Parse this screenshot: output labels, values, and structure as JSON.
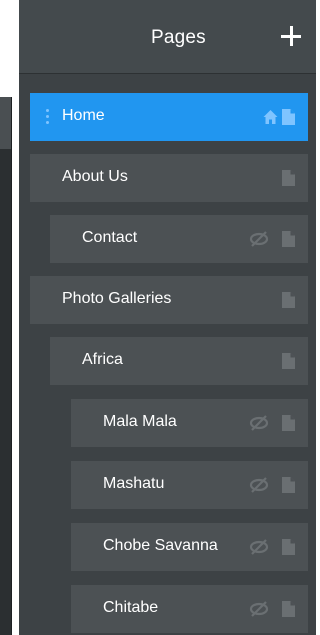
{
  "panel": {
    "title": "Pages",
    "add_icon": "plus-icon"
  },
  "colors": {
    "panel_bg": "#3d4245",
    "header_bg": "#444a4d",
    "item_bg": "#4c5154",
    "active_bg": "#2196f0",
    "icon": "#6a6f72"
  },
  "pages": [
    {
      "label": "Home",
      "level": 0,
      "active": true,
      "home": true,
      "hidden": false
    },
    {
      "label": "About Us",
      "level": 0,
      "active": false,
      "home": false,
      "hidden": false
    },
    {
      "label": "Contact",
      "level": 1,
      "active": false,
      "home": false,
      "hidden": true
    },
    {
      "label": "Photo Galleries",
      "level": 0,
      "active": false,
      "home": false,
      "hidden": false
    },
    {
      "label": "Africa",
      "level": 1,
      "active": false,
      "home": false,
      "hidden": false
    },
    {
      "label": "Mala Mala",
      "level": 2,
      "active": false,
      "home": false,
      "hidden": true
    },
    {
      "label": "Mashatu",
      "level": 2,
      "active": false,
      "home": false,
      "hidden": true
    },
    {
      "label": "Chobe Savanna",
      "level": 2,
      "active": false,
      "home": false,
      "hidden": true
    },
    {
      "label": "Chitabe",
      "level": 2,
      "active": false,
      "home": false,
      "hidden": true
    }
  ]
}
